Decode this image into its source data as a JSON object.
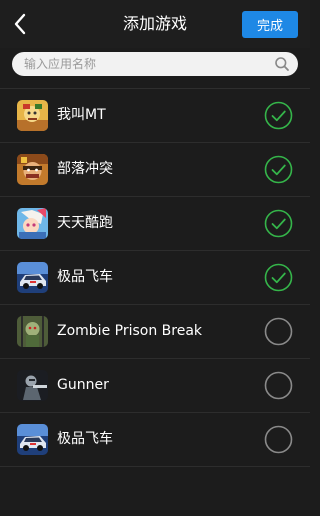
{
  "header": {
    "title": "添加游戏",
    "done_label": "完成",
    "back_icon": "chevron-left-icon"
  },
  "search": {
    "placeholder": "输入应用名称",
    "value": "",
    "icon": "search-icon"
  },
  "colors": {
    "background": "#1c1c1c",
    "accent": "#1e88e5",
    "checked": "#35b54a",
    "unchecked": "#8a8a8a"
  },
  "games": [
    {
      "name": "我叫MT",
      "selected": true,
      "icon": "mt-game-icon"
    },
    {
      "name": "部落冲突",
      "selected": true,
      "icon": "clash-of-clans-icon"
    },
    {
      "name": "天天酷跑",
      "selected": true,
      "icon": "tiantian-kupao-icon"
    },
    {
      "name": "极品飞车",
      "selected": true,
      "icon": "need-for-speed-icon"
    },
    {
      "name": "Zombie Prison Break",
      "selected": false,
      "icon": "zombie-prison-break-icon"
    },
    {
      "name": "Gunner",
      "selected": false,
      "icon": "gunner-icon"
    },
    {
      "name": "极品飞车",
      "selected": false,
      "icon": "need-for-speed-icon"
    }
  ]
}
